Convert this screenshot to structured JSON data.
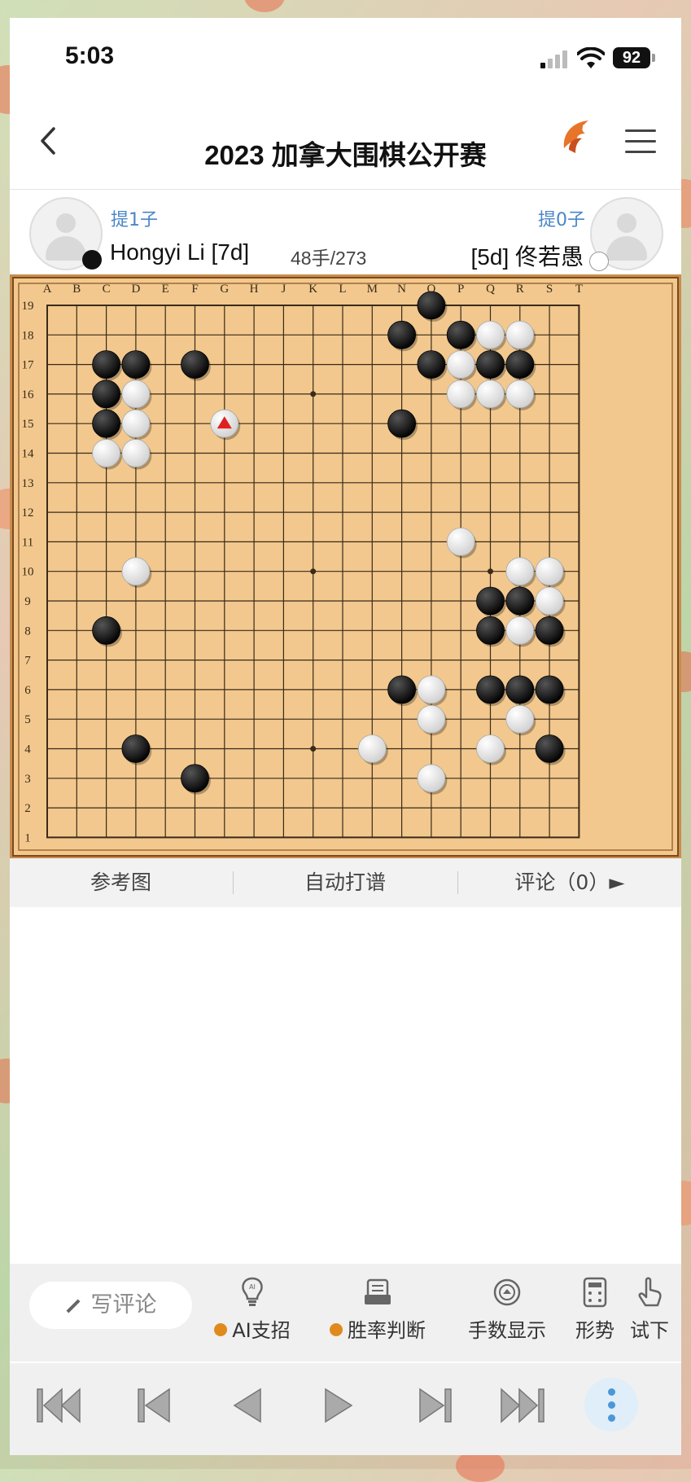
{
  "status": {
    "time": "5:03",
    "battery": "92"
  },
  "nav": {
    "title": "2023 加拿大围棋公开赛",
    "back_icon": "chevron-left-icon",
    "menu_icon": "hamburger-menu-icon"
  },
  "players": {
    "black": {
      "name": "Hongyi Li [7d]",
      "captures": "提1子",
      "color": "black"
    },
    "white": {
      "name": "[5d] 佟若愚",
      "captures": "提0子",
      "color": "white"
    },
    "move_counter": "48手/273"
  },
  "board": {
    "size": 19,
    "columns": [
      "A",
      "B",
      "C",
      "D",
      "E",
      "F",
      "G",
      "H",
      "J",
      "K",
      "L",
      "M",
      "N",
      "O",
      "P",
      "Q",
      "R",
      "S",
      "T"
    ],
    "rows": [
      "19",
      "18",
      "17",
      "16",
      "15",
      "14",
      "13",
      "12",
      "11",
      "10",
      "9",
      "8",
      "7",
      "6",
      "5",
      "4",
      "3",
      "2",
      "1"
    ],
    "star_points": [
      [
        3,
        3
      ],
      [
        3,
        9
      ],
      [
        3,
        15
      ],
      [
        9,
        3
      ],
      [
        9,
        9
      ],
      [
        9,
        15
      ],
      [
        15,
        3
      ],
      [
        15,
        9
      ],
      [
        15,
        15
      ]
    ],
    "black_stones": [
      [
        13,
        0
      ],
      [
        12,
        1
      ],
      [
        14,
        1
      ],
      [
        2,
        2
      ],
      [
        3,
        2
      ],
      [
        5,
        2
      ],
      [
        13,
        2
      ],
      [
        15,
        2
      ],
      [
        16,
        2
      ],
      [
        2,
        3
      ],
      [
        2,
        4
      ],
      [
        12,
        4
      ],
      [
        15,
        10
      ],
      [
        16,
        10
      ],
      [
        2,
        11
      ],
      [
        15,
        11
      ],
      [
        17,
        11
      ],
      [
        12,
        13
      ],
      [
        15,
        13
      ],
      [
        16,
        13
      ],
      [
        17,
        13
      ],
      [
        3,
        15
      ],
      [
        17,
        15
      ],
      [
        5,
        16
      ]
    ],
    "white_stones": [
      [
        15,
        1
      ],
      [
        16,
        1
      ],
      [
        14,
        2
      ],
      [
        3,
        3
      ],
      [
        14,
        3
      ],
      [
        15,
        3
      ],
      [
        16,
        3
      ],
      [
        3,
        4
      ],
      [
        2,
        5
      ],
      [
        3,
        5
      ],
      [
        6,
        4
      ],
      [
        14,
        8
      ],
      [
        3,
        9
      ],
      [
        16,
        9
      ],
      [
        17,
        9
      ],
      [
        17,
        10
      ],
      [
        16,
        11
      ],
      [
        13,
        13
      ],
      [
        13,
        14
      ],
      [
        16,
        14
      ],
      [
        11,
        15
      ],
      [
        15,
        15
      ],
      [
        13,
        16
      ]
    ],
    "last_move": [
      6,
      4
    ],
    "last_move_color": "#e02020",
    "board_color": "#f2c88e"
  },
  "subbar": {
    "tabs": [
      "参考图",
      "自动打谱",
      "评论（0）►"
    ]
  },
  "actions": {
    "comment_button": "写评论",
    "tools": [
      {
        "label": "AI支招",
        "icon": "lightbulb-ai-icon",
        "coin": true
      },
      {
        "label": "胜率判断",
        "icon": "ai-robot-icon",
        "coin": true
      },
      {
        "label": "手数显示",
        "icon": "move-number-icon",
        "coin": false
      },
      {
        "label": "形势",
        "icon": "calculator-icon",
        "coin": false
      },
      {
        "label": "试下",
        "icon": "hand-pointer-icon",
        "coin": false
      }
    ]
  },
  "playback": {
    "buttons": [
      "first-move-icon",
      "back-ten-icon",
      "previous-move-icon",
      "next-move-icon",
      "forward-ten-icon",
      "last-move-icon"
    ],
    "more_icon": "more-dots-icon"
  }
}
